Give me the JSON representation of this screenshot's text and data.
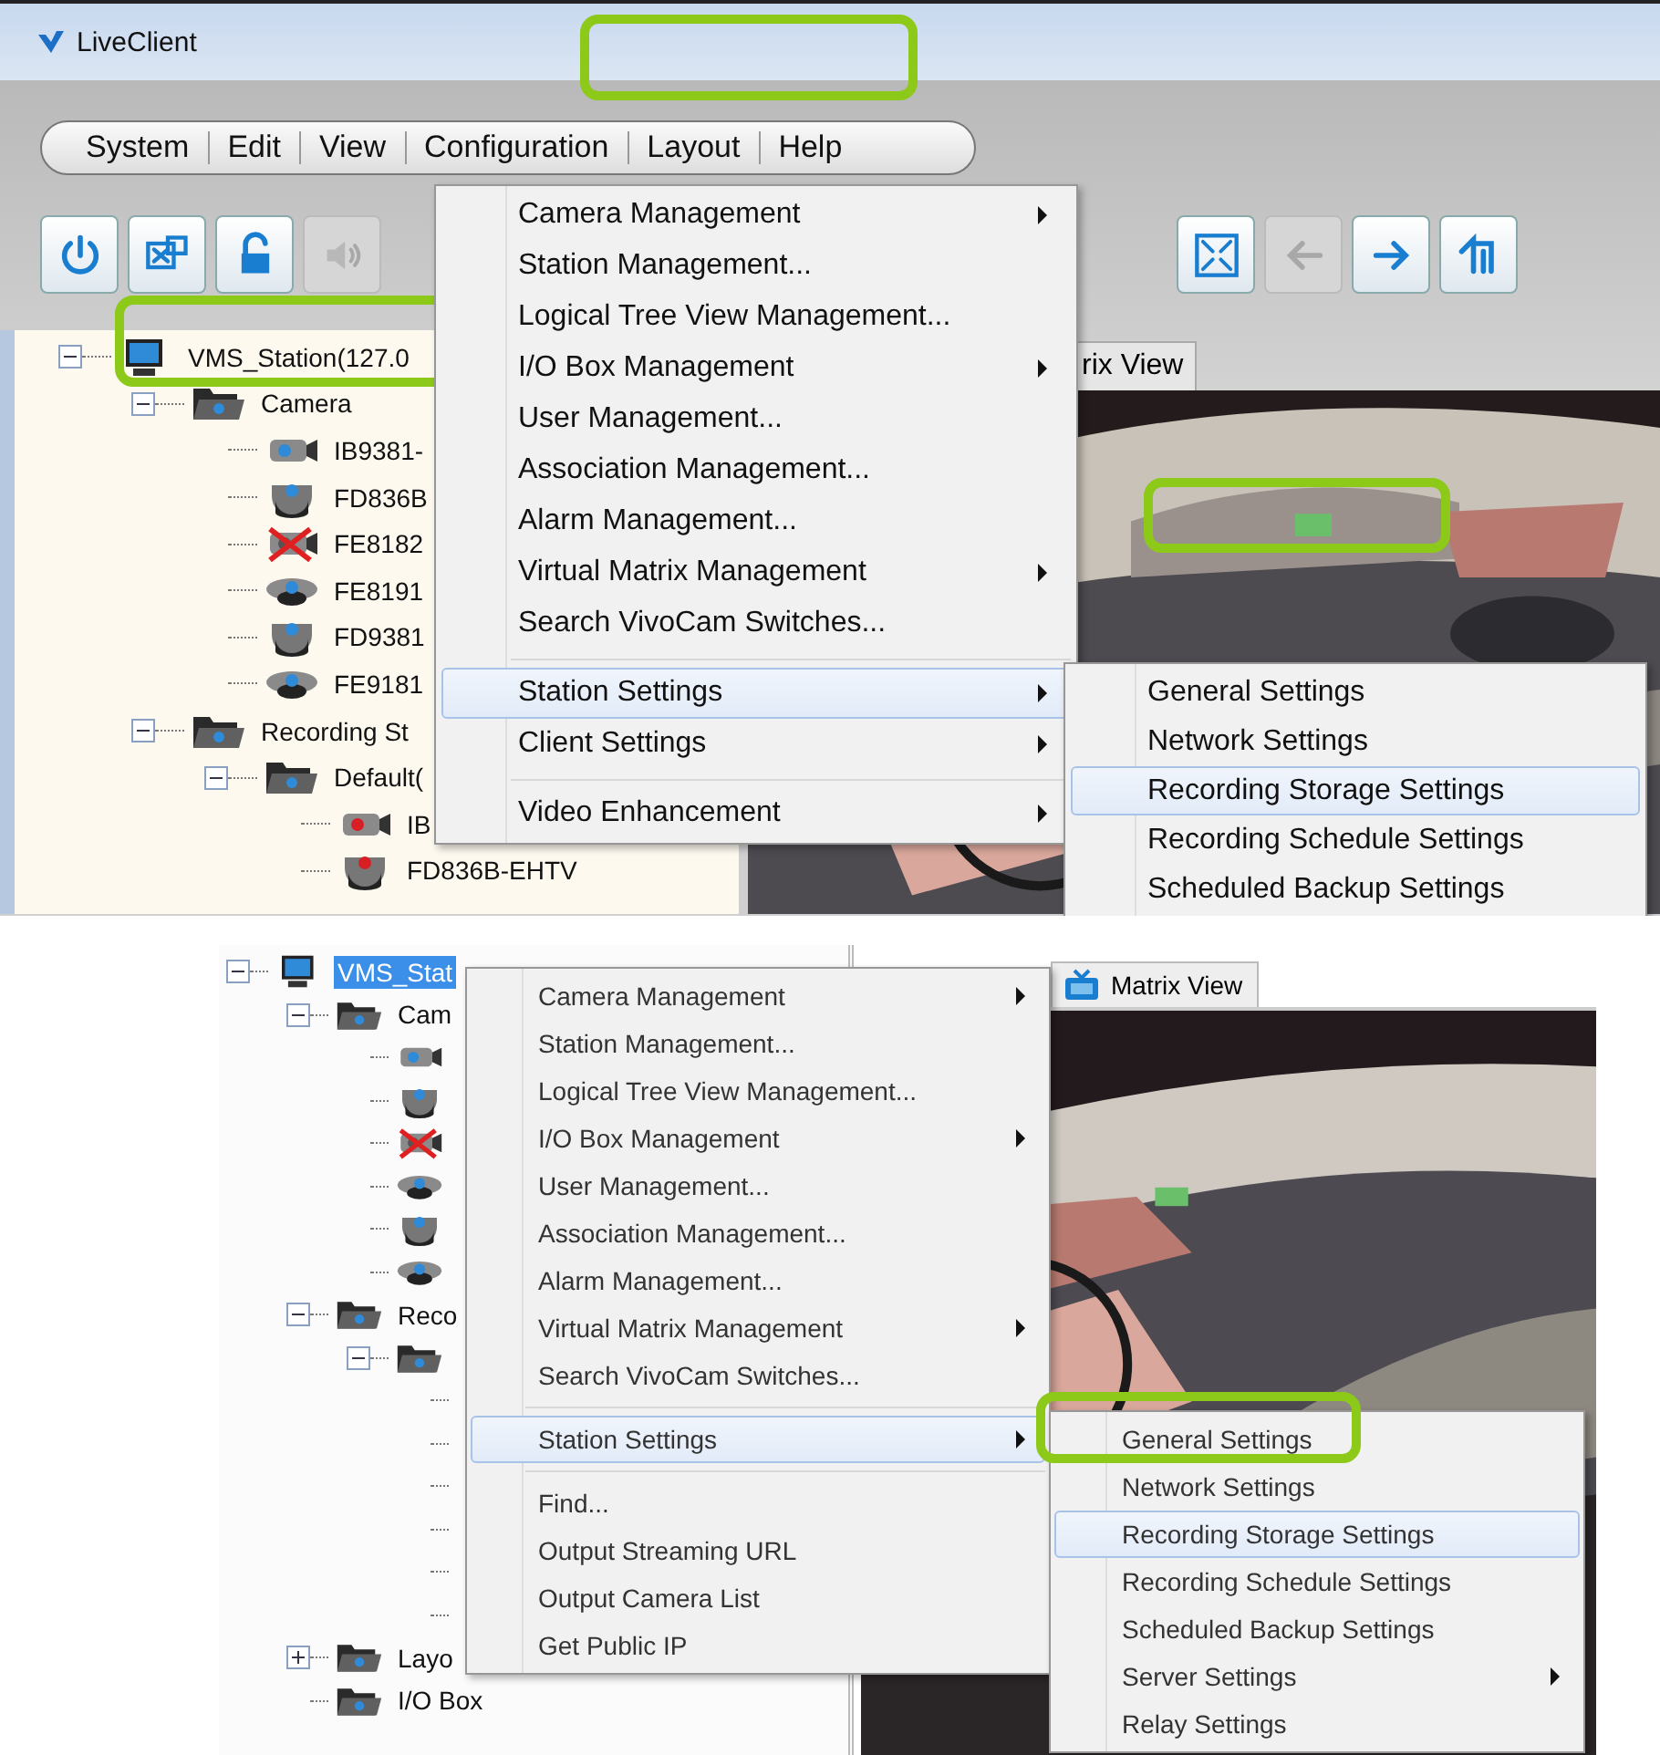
{
  "top": {
    "window": {
      "title": "LiveClient"
    },
    "menubar": [
      {
        "label": "System"
      },
      {
        "label": "Edit"
      },
      {
        "label": "View"
      },
      {
        "label": "Configuration"
      },
      {
        "label": "Layout"
      },
      {
        "label": "Help"
      }
    ],
    "toolbar_left": [
      {
        "kind": "power",
        "disabled": false
      },
      {
        "kind": "remote",
        "disabled": false
      },
      {
        "kind": "lock",
        "disabled": false
      },
      {
        "kind": "speaker",
        "disabled": true
      }
    ],
    "toolbar_right": [
      {
        "kind": "fullscreen",
        "disabled": false
      },
      {
        "kind": "back",
        "disabled": true
      },
      {
        "kind": "forward",
        "disabled": false
      },
      {
        "kind": "return",
        "disabled": false
      }
    ],
    "tree": [
      {
        "label": "VMS_Station(127.0",
        "kind": "station",
        "expanded": true,
        "selected": false,
        "children": [
          {
            "label": "Camera",
            "kind": "folder",
            "expanded": true,
            "selected": false,
            "children": [
              {
                "label": "IB9381-",
                "kind": "bullet",
                "color": "#2f8ad8",
                "selected": false
              },
              {
                "label": "FD836B",
                "kind": "dome",
                "color": "#2f8ad8",
                "selected": false
              },
              {
                "label": "FE8182",
                "kind": "bullet-offline",
                "selected": false
              },
              {
                "label": "FE8191",
                "kind": "fisheye",
                "color": "#2f8ad8",
                "selected": false
              },
              {
                "label": "FD9381",
                "kind": "dome",
                "color": "#2f8ad8",
                "selected": false
              },
              {
                "label": "FE9181",
                "kind": "fisheye",
                "color": "#2f8ad8",
                "selected": false
              }
            ]
          },
          {
            "label": "Recording St",
            "kind": "folder",
            "expanded": true,
            "selected": false,
            "children": [
              {
                "label": "Default(",
                "kind": "folder",
                "expanded": true,
                "selected": false,
                "children": [
                  {
                    "label": "IB",
                    "kind": "bullet",
                    "color": "#d81f26",
                    "selected": false
                  },
                  {
                    "label": "FD836B-EHTV",
                    "kind": "dome",
                    "color": "#d81f26",
                    "selected": false
                  }
                ]
              }
            ]
          }
        ]
      }
    ],
    "tab": {
      "label": "rix View"
    },
    "context_menu": [
      {
        "kind": "item",
        "label": "Camera Management",
        "submenu": true,
        "selected": false
      },
      {
        "kind": "item",
        "label": "Station Management...",
        "submenu": false,
        "selected": false
      },
      {
        "kind": "item",
        "label": "Logical Tree View Management...",
        "submenu": false,
        "selected": false
      },
      {
        "kind": "item",
        "label": "I/O Box Management",
        "submenu": true,
        "selected": false
      },
      {
        "kind": "item",
        "label": "User Management...",
        "submenu": false,
        "selected": false
      },
      {
        "kind": "item",
        "label": "Association Management...",
        "submenu": false,
        "selected": false
      },
      {
        "kind": "item",
        "label": "Alarm Management...",
        "submenu": false,
        "selected": false
      },
      {
        "kind": "item",
        "label": "Virtual Matrix Management",
        "submenu": true,
        "selected": false
      },
      {
        "kind": "item",
        "label": "Search VivoCam Switches...",
        "submenu": false,
        "selected": false
      },
      {
        "kind": "separator"
      },
      {
        "kind": "item",
        "label": "Station Settings",
        "submenu": true,
        "selected": true
      },
      {
        "kind": "item",
        "label": "Client Settings",
        "submenu": true,
        "selected": false
      },
      {
        "kind": "separator"
      },
      {
        "kind": "item",
        "label": "Video Enhancement",
        "submenu": true,
        "selected": false
      }
    ],
    "submenu": [
      {
        "kind": "item",
        "label": "General Settings",
        "submenu": false,
        "selected": false
      },
      {
        "kind": "item",
        "label": "Network Settings",
        "submenu": false,
        "selected": false
      },
      {
        "kind": "item",
        "label": "Recording Storage Settings",
        "submenu": false,
        "selected": true
      },
      {
        "kind": "item",
        "label": "Recording Schedule Settings",
        "submenu": false,
        "selected": false
      },
      {
        "kind": "item",
        "label": "Scheduled Backup Settings",
        "submenu": false,
        "selected": false
      }
    ]
  },
  "bottom": {
    "tree": [
      {
        "label": "VMS_Stat",
        "kind": "station",
        "expanded": true,
        "selected": true,
        "children": [
          {
            "label": "Cam",
            "kind": "folder",
            "expanded": true,
            "selected": false,
            "children": [
              {
                "kind": "bullet",
                "color": "#2f8ad8"
              },
              {
                "kind": "dome",
                "color": "#2f8ad8"
              },
              {
                "kind": "bullet-offline"
              },
              {
                "kind": "fisheye",
                "color": "#2f8ad8"
              },
              {
                "kind": "dome",
                "color": "#2f8ad8"
              },
              {
                "kind": "fisheye",
                "color": "#2f8ad8"
              }
            ]
          },
          {
            "label": "Reco",
            "kind": "folder",
            "expanded": true,
            "selected": false,
            "children": [
              {
                "kind": "folder",
                "expanded": true,
                "children": [
                  {
                    "kind": "line"
                  },
                  {
                    "kind": "line"
                  },
                  {
                    "kind": "line"
                  },
                  {
                    "kind": "line"
                  },
                  {
                    "kind": "line"
                  },
                  {
                    "kind": "line"
                  }
                ]
              }
            ]
          },
          {
            "label": "Layo",
            "kind": "folder",
            "expanded": false,
            "selected": false
          },
          {
            "label": "I/O Box",
            "kind": "folder",
            "selected": false
          }
        ]
      }
    ],
    "tab": {
      "label": "Matrix View"
    },
    "context_menu": [
      {
        "kind": "item",
        "label": "Camera Management",
        "submenu": true,
        "selected": false
      },
      {
        "kind": "item",
        "label": "Station Management...",
        "submenu": false,
        "selected": false
      },
      {
        "kind": "item",
        "label": "Logical Tree View Management...",
        "submenu": false,
        "selected": false
      },
      {
        "kind": "item",
        "label": "I/O Box Management",
        "submenu": true,
        "selected": false
      },
      {
        "kind": "item",
        "label": "User Management...",
        "submenu": false,
        "selected": false
      },
      {
        "kind": "item",
        "label": "Association Management...",
        "submenu": false,
        "selected": false
      },
      {
        "kind": "item",
        "label": "Alarm Management...",
        "submenu": false,
        "selected": false
      },
      {
        "kind": "item",
        "label": "Virtual Matrix Management",
        "submenu": true,
        "selected": false
      },
      {
        "kind": "item",
        "label": "Search VivoCam Switches...",
        "submenu": false,
        "selected": false
      },
      {
        "kind": "separator"
      },
      {
        "kind": "item",
        "label": "Station Settings",
        "submenu": true,
        "selected": true
      },
      {
        "kind": "separator"
      },
      {
        "kind": "item",
        "label": "Find...",
        "submenu": false,
        "selected": false
      },
      {
        "kind": "item",
        "label": "Output Streaming URL",
        "submenu": false,
        "selected": false
      },
      {
        "kind": "item",
        "label": "Output Camera List",
        "submenu": false,
        "selected": false
      },
      {
        "kind": "item",
        "label": "Get Public IP",
        "submenu": false,
        "selected": false
      }
    ],
    "submenu": [
      {
        "kind": "item",
        "label": "General Settings",
        "submenu": false,
        "selected": false
      },
      {
        "kind": "item",
        "label": "Network Settings",
        "submenu": false,
        "selected": false
      },
      {
        "kind": "item",
        "label": "Recording Storage Settings",
        "submenu": false,
        "selected": true
      },
      {
        "kind": "item",
        "label": "Recording Schedule Settings",
        "submenu": false,
        "selected": false
      },
      {
        "kind": "item",
        "label": "Scheduled Backup Settings",
        "submenu": false,
        "selected": false
      },
      {
        "kind": "item",
        "label": "Server Settings",
        "submenu": true,
        "selected": false
      },
      {
        "kind": "item",
        "label": "Relay Settings",
        "submenu": false,
        "selected": false
      }
    ]
  }
}
